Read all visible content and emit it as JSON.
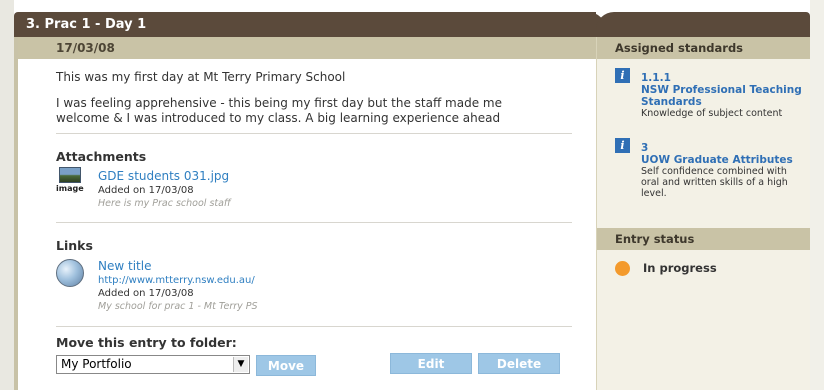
{
  "entry": {
    "title": "3. Prac 1 - Day 1",
    "date": "17/03/08",
    "paragraph_1": "This was my first day at Mt Terry Primary School",
    "paragraph_2_line_1": "I was feeling apprehensive - this being my first day but the staff made me",
    "paragraph_2_line_2": "welcome & I was introduced to my class. A big learning experience ahead"
  },
  "attachments": {
    "heading": "Attachments",
    "items": [
      {
        "icon": "image-file-icon",
        "icon_label": "image",
        "name": "GDE students 031.jpg",
        "added": "Added on 17/03/08",
        "note": "Here is my Prac school staff"
      }
    ]
  },
  "links": {
    "heading": "Links",
    "items": [
      {
        "icon": "globe-icon",
        "title": "New title",
        "url": "http://www.mtterry.nsw.edu.au/",
        "added": "Added on 17/03/08",
        "note": "My school for prac 1 - Mt Terry PS"
      }
    ]
  },
  "move": {
    "heading": "Move this entry to folder:",
    "selected_folder": "My Portfolio",
    "move_label": "Move",
    "edit_label": "Edit",
    "delete_label": "Delete"
  },
  "sidebar": {
    "standards_heading": "Assigned standards",
    "standards": [
      {
        "code": "1.1.1",
        "title_line_1": "NSW Professional Teaching",
        "title_line_2": "Standards",
        "desc_line_1": "Knowledge of subject content"
      },
      {
        "code": "3",
        "title_line_1": "UOW Graduate Attributes",
        "desc_line_1": "Self confidence combined with",
        "desc_line_2": "oral and written skills of a high",
        "desc_line_3": "level."
      }
    ],
    "status_heading": "Entry status",
    "status": "In progress"
  },
  "colors": {
    "header": "#5b4a3b",
    "section_bar": "#c9c3a6",
    "link": "#2f7fc1",
    "button": "#9ec7e6",
    "status": "#f39a2c"
  }
}
